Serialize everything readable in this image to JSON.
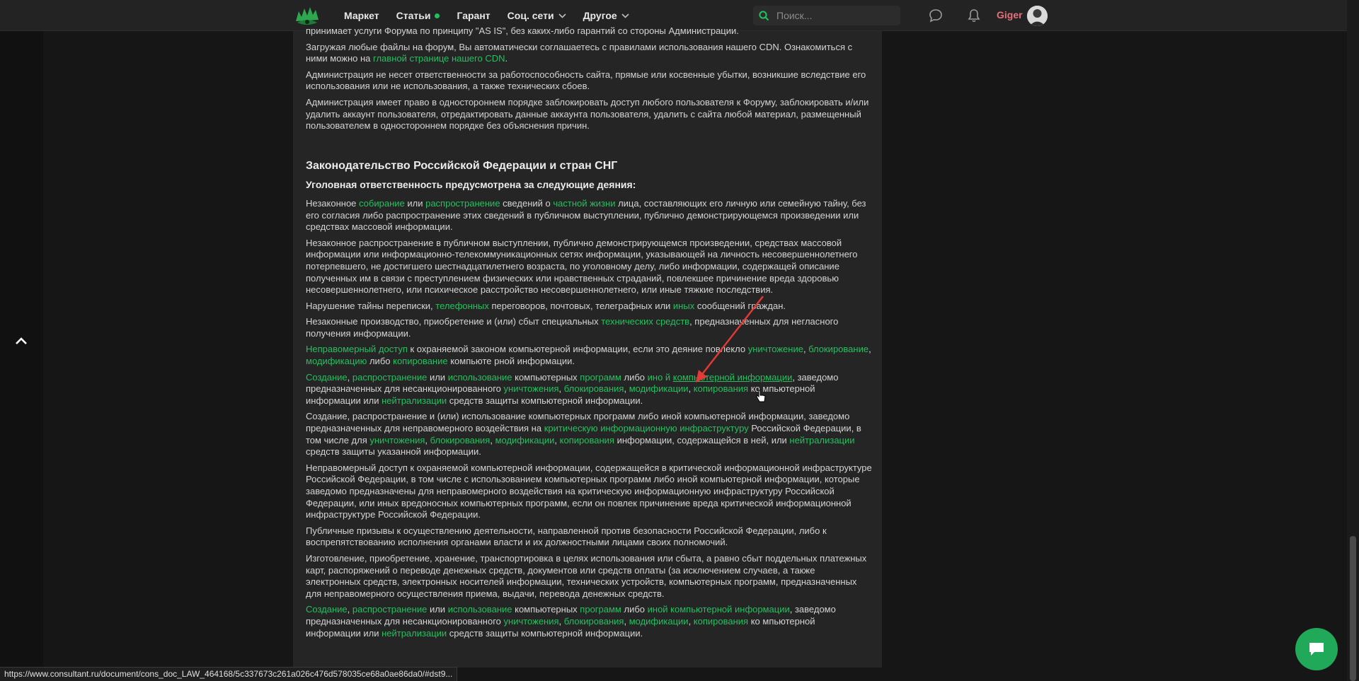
{
  "header": {
    "nav": [
      {
        "label": "Маркет"
      },
      {
        "label": "Статьи"
      },
      {
        "label": "Гарант"
      },
      {
        "label": "Соц. сети"
      },
      {
        "label": "Другое"
      }
    ],
    "search_placeholder": "Поиск...",
    "username": "Giger"
  },
  "colors": {
    "accent": "#22c15e",
    "username": "#e6707a",
    "header_bg": "#232323",
    "content_bg": "#252525"
  },
  "icons": [
    "logo-icon",
    "search-icon",
    "chat-icon",
    "bell-icon",
    "chevron-up-icon",
    "message-icon"
  ],
  "content": {
    "p_top_cut": "принимает услуги Форума по принципу \"AS IS\", без каких-либо гарантий со стороны Администрации.",
    "p_cdn_a": "Загружая любые файлы на форум, Вы автоматически соглашаетесь с правилами использования нашего CDN. Ознакомиться с ними можно на ",
    "p_cdn_link": "главной странице нашего CDN",
    "p_cdn_b": ".",
    "p_admin1": "Администрация не несет ответственности за работоспособность сайта, прямые или косвенные убытки, возникшие вследствие его использования или не использования, а также технических сбоев.",
    "p_admin2": "Администрация имеет право в одностороннем порядке заблокировать доступ любого пользователя к Форуму, заблокировать и/или удалить аккаунт пользователя, отредактировать данные аккаунта пользователя, удалить с сайта любой материал, размещенный пользователем в одностороннем порядке без объяснения причин.",
    "h2": "Законодательство Российской Федерации и стран СНГ",
    "h3": "Уголовная ответственность предусмотрена за следующие деяния:",
    "p1": {
      "t1": "Незаконное ",
      "l1": "собирание",
      "t2": " или ",
      "l2": "распространение",
      "t3": " сведений о ",
      "l3": "частной жизни",
      "t4": " лица, составляющих его личную или семейную тайну, без его согласия либо распространение этих сведений в публичном выступлении, публично демонстрирующемся произведении или средствах массовой информации."
    },
    "p2": "Незаконное распространение в публичном выступлении, публично демонстрирующемся произведении, средствах массовой информации или информационно-телекоммуникационных сетях информации, указывающей на личность несовершеннолетнего потерпевшего, не достигшего шестнадцатилетнего возраста, по уголовному делу, либо информации, содержащей описание полученных им в связи с преступлением физических или нравственных страданий, повлекшее причинение вреда здоровью несовершеннолетнего, или психическое расстройство несовершеннолетнего, или иные тяжкие последствия.",
    "p3": {
      "t1": "Нарушение тайны переписки, ",
      "l1": "телефонных",
      "t2": " переговоров, почтовых, телеграфных или ",
      "l2": "иных",
      "t3": " сообщений граждан."
    },
    "p4": {
      "t1": "Незаконные производство, приобретение и (или) сбыт специальных ",
      "l1": "технических средств",
      "t2": ", предназначенных для негласного получения информации."
    },
    "p5": {
      "l1": "Неправомерный доступ",
      "t1": " к охраняемой законом компьютерной информации, если это деяние повлекло ",
      "l2": "уничтожение",
      "t2": ", ",
      "l3": "блокирование",
      "t3": ", ",
      "l4": "модификацию",
      "t4": " либо ",
      "l5": "копирование",
      "t5": " компьюте рной информации."
    },
    "p6": {
      "l1": "Создание",
      "t1": ", ",
      "l2": "распространение",
      "t2": " или ",
      "l3": "использование",
      "t3": " компьютерных ",
      "l4": "программ",
      "t4": " либо ",
      "l5": "ино й",
      "t5": " ",
      "l6": "компьютерной информации",
      "t6": ", заведомо предназначенных для несанкционированного ",
      "l7": "уничтожения",
      "t7": ", ",
      "l8": "блокирования",
      "t8": ", ",
      "l9": "модификации",
      "t9": ", ",
      "l10": "копирования",
      "t10": " ко мпьютерной информации или ",
      "l11": "нейтрализации",
      "t11": " средств защиты компьютерной информации."
    },
    "p7": {
      "t1": "Создание, распространение и (или) использование компьютерных программ либо иной компьютерной информации, заведомо предназначенных для неправомерного воздействия на ",
      "l1": "критическую информационную инфраструктуру",
      "t2": " Российской Федерации, в том числе для ",
      "l2": "уничтожения",
      "t3": ", ",
      "l3": "блокирования",
      "t4": ", ",
      "l4": "модификации",
      "t5": ", ",
      "l5": "копирования",
      "t6": " информации, содержащейся в ней, или ",
      "l6": "нейтрализации",
      "t7": " средств защиты указанной информации."
    },
    "p8": "Неправомерный доступ к охраняемой компьютерной информации, содержащейся в критической информационной инфраструктуре Российской Федерации, в том числе с использованием компьютерных программ либо иной компьютерной информации, которые заведомо предназначены для неправомерного воздействия на критическую информационную инфраструктуру Российской Федерации, или иных вредоносных компьютерных программ, если он повлек причинение вреда критической информационной инфраструктуре Российской Федерации.",
    "p9": "Публичные призывы к осуществлению деятельности, направленной против безопасности Российской Федерации, либо к воспрепятствованию исполнения органами власти и их должностными лицами своих полномочий.",
    "p10": "Изготовление, приобретение, хранение, транспортировка в целях использования или сбыта, а равно сбыт поддельных платежных карт, распоряжений о переводе денежных средств, документов или средств оплаты (за исключением случаев, а также электронных средств, электронных носителей информации, технических устройств, компьютерных программ, предназначенных для неправомерного осуществления приема, выдачи, перевода денежных средств.",
    "p11": {
      "l1": "Создание",
      "t1": ", ",
      "l2": "распространение",
      "t2": " или ",
      "l3": "использование",
      "t3": " компьютерных ",
      "l4": "программ",
      "t4": " либо ",
      "l5": "иной компьютерной информации",
      "t5": ", заведомо предназначенных для несанкционированного ",
      "l6": "уничтожения",
      "t6": ", ",
      "l7": "блокирования",
      "t7": ", ",
      "l8": "модификации",
      "t8": ", ",
      "l9": "копирования",
      "t9": " ко мпьютерной информации или ",
      "l10": "нейтрализации",
      "t10": " средств защиты компьютерной информации."
    }
  },
  "statusbar": {
    "url": "https://www.consultant.ru/document/cons_doc_LAW_464168/5c337673c261a026c476d578035ce68a0ae86da0/#dst9..."
  }
}
